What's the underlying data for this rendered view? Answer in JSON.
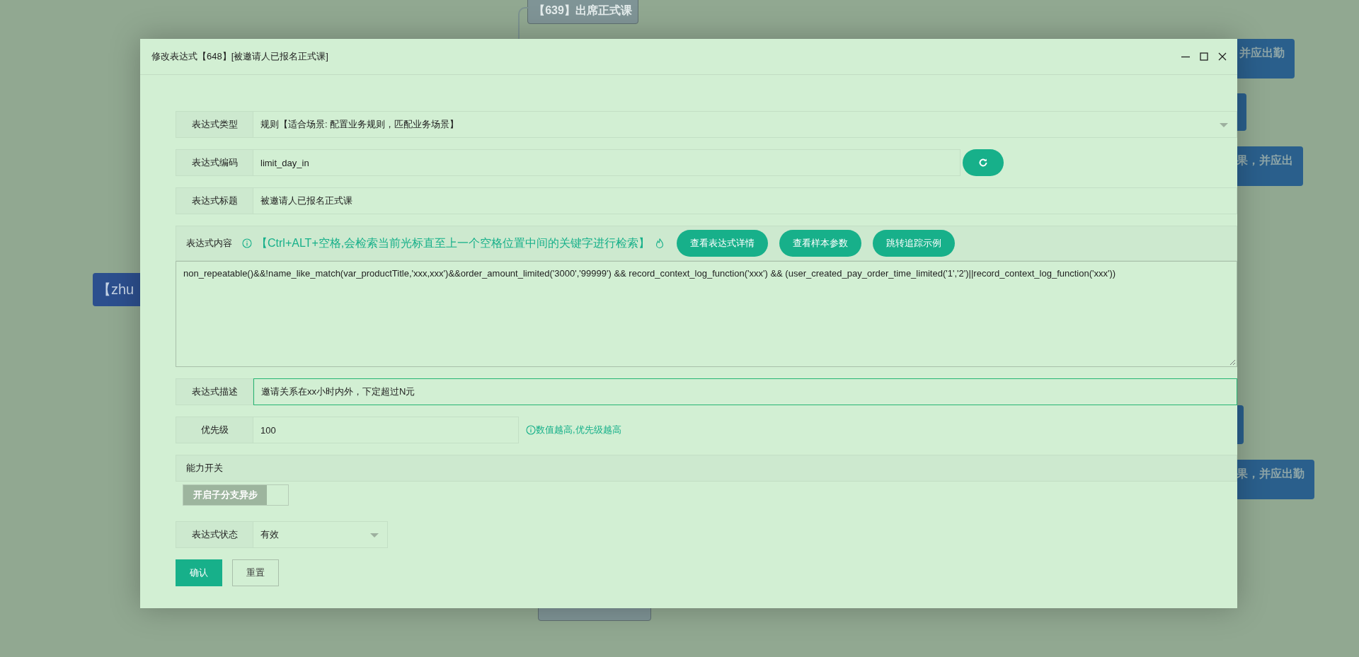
{
  "background_nodes": [
    {
      "text": "【639】出席正式课",
      "kind": "grey"
    },
    {
      "text": "并应出勤",
      "kind": "blue"
    },
    {
      "kind": "blue"
    },
    {
      "text": "果，并应出",
      "kind": "blue"
    },
    {
      "text": "【zhu",
      "kind": "navy"
    },
    {
      "kind": "blue"
    },
    {
      "text": "果，并应出勤",
      "kind": "blue"
    },
    {
      "kind": "grey"
    }
  ],
  "dialog": {
    "title": "修改表达式【648】[被邀请人已报名正式课]",
    "type": {
      "label": "表达式类型",
      "value": "规则【适合场景: 配置业务规则，匹配业务场景】"
    },
    "code": {
      "label": "表达式编码",
      "value": "limit_day_in"
    },
    "title_field": {
      "label": "表达式标题",
      "value": "被邀请人已报名正式课"
    },
    "content": {
      "label": "表达式内容",
      "hint": "【Ctrl+ALT+空格,会检索当前光标直至上一个空格位置中间的关键字进行检索】",
      "buttons": [
        "查看表达式详情",
        "查看样本参数",
        "跳转追踪示例"
      ],
      "value": "non_repeatable()&&!name_like_match(var_productTitle,'xxx,xxx')&&order_amount_limited('3000','99999') && record_context_log_function('xxx') && (user_created_pay_order_time_limited('1','2')||record_context_log_function('xxx'))"
    },
    "description": {
      "label": "表达式描述",
      "value": "邀请关系在xx小时内外，下定超过N元",
      "focused": true
    },
    "priority": {
      "label": "优先级",
      "value": "100",
      "hint": "数值越高,优先级越高"
    },
    "switches": {
      "label": "能力开关",
      "items": [
        {
          "label": "开启子分支异步",
          "on": false
        }
      ]
    },
    "status": {
      "label": "表达式状态",
      "value": "有效"
    },
    "buttons": [
      {
        "label": "确认",
        "kind": "primary"
      },
      {
        "label": "重置",
        "kind": "plain"
      }
    ]
  }
}
